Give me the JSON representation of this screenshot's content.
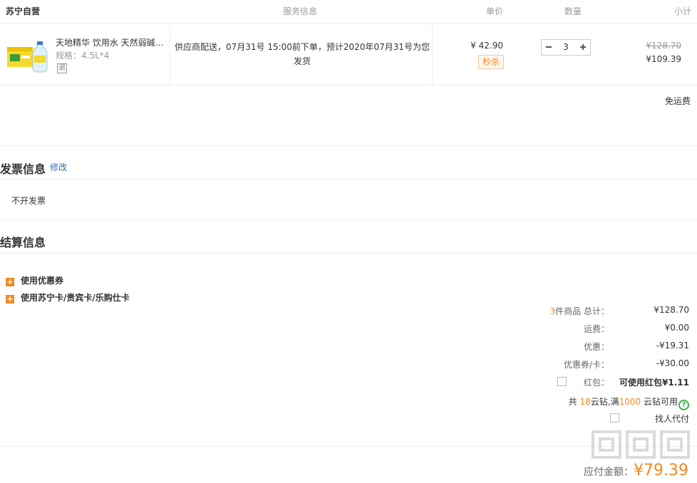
{
  "header": {
    "store": "苏宁自营",
    "service": "服务信息",
    "price": "单价",
    "quantity": "数量",
    "subtotal": "小计"
  },
  "product": {
    "name": "天地精华 饮用水 天然弱碱…",
    "spec": "规格：4.5L*4",
    "return_badge": "退",
    "service_text": "供应商配送，07月31号 15:00前下单，预计2020年07月31号为您发货",
    "unit_price": "¥ 42.90",
    "flash_sale": "秒杀",
    "quantity": "3",
    "original_subtotal": "¥128.70",
    "subtotal": "¥109.39"
  },
  "shipping_note": "免运费",
  "invoice": {
    "title": "发票信息",
    "edit": "修改",
    "value": "不开发票"
  },
  "settlement": {
    "title": "结算信息",
    "use_coupon": "使用优惠券",
    "use_card": "使用苏宁卡/贵宾卡/乐购仕卡",
    "items_count": "3",
    "items_label": "件商品 总计：",
    "items_total": "¥128.70",
    "freight_label": "运费：",
    "freight": "¥0.00",
    "discount_label": "优惠：",
    "discount": "-¥19.31",
    "coupon_label": "优惠券/卡：",
    "coupon": "-¥30.00",
    "redpack_label": "红包：",
    "redpack": "可使用红包¥1.11",
    "yunzuan_pre": "共",
    "yunzuan_count": "18",
    "yunzuan_mid": "云钻,满",
    "yunzuan_threshold": "1000",
    "yunzuan_post": "云钻可用",
    "proxy_pay": "找人代付",
    "payable_label": "应付金额：",
    "payable": "¥79.39"
  },
  "colors": {
    "accent": "#f08a24",
    "link": "#2d6fb7",
    "help": "#36b24a"
  }
}
